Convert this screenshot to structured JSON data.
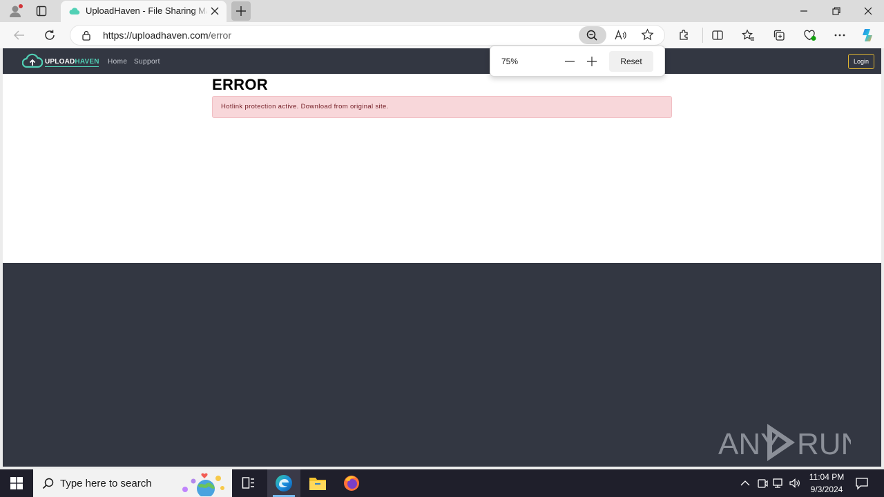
{
  "browser": {
    "tab_title": "UploadHaven - File Sharing Made Simple",
    "url_host": "https://uploadhaven.com",
    "url_path": "/error",
    "zoom_level": "75%",
    "zoom_reset_label": "Reset"
  },
  "site": {
    "logo_part1": "UPLOAD",
    "logo_part2": "HAVEN",
    "nav": [
      "Home",
      "Support"
    ],
    "login_label": "Login",
    "accent_color": "#51d0b5",
    "nav_bg_color": "#333742"
  },
  "content": {
    "heading": "ERROR",
    "alert_message": "Hotlink protection active. Download from original site."
  },
  "watermark": {
    "left": "ANY",
    "right": "RUN"
  },
  "taskbar": {
    "search_placeholder": "Type here to search",
    "time": "11:04 PM",
    "date": "9/3/2024"
  }
}
